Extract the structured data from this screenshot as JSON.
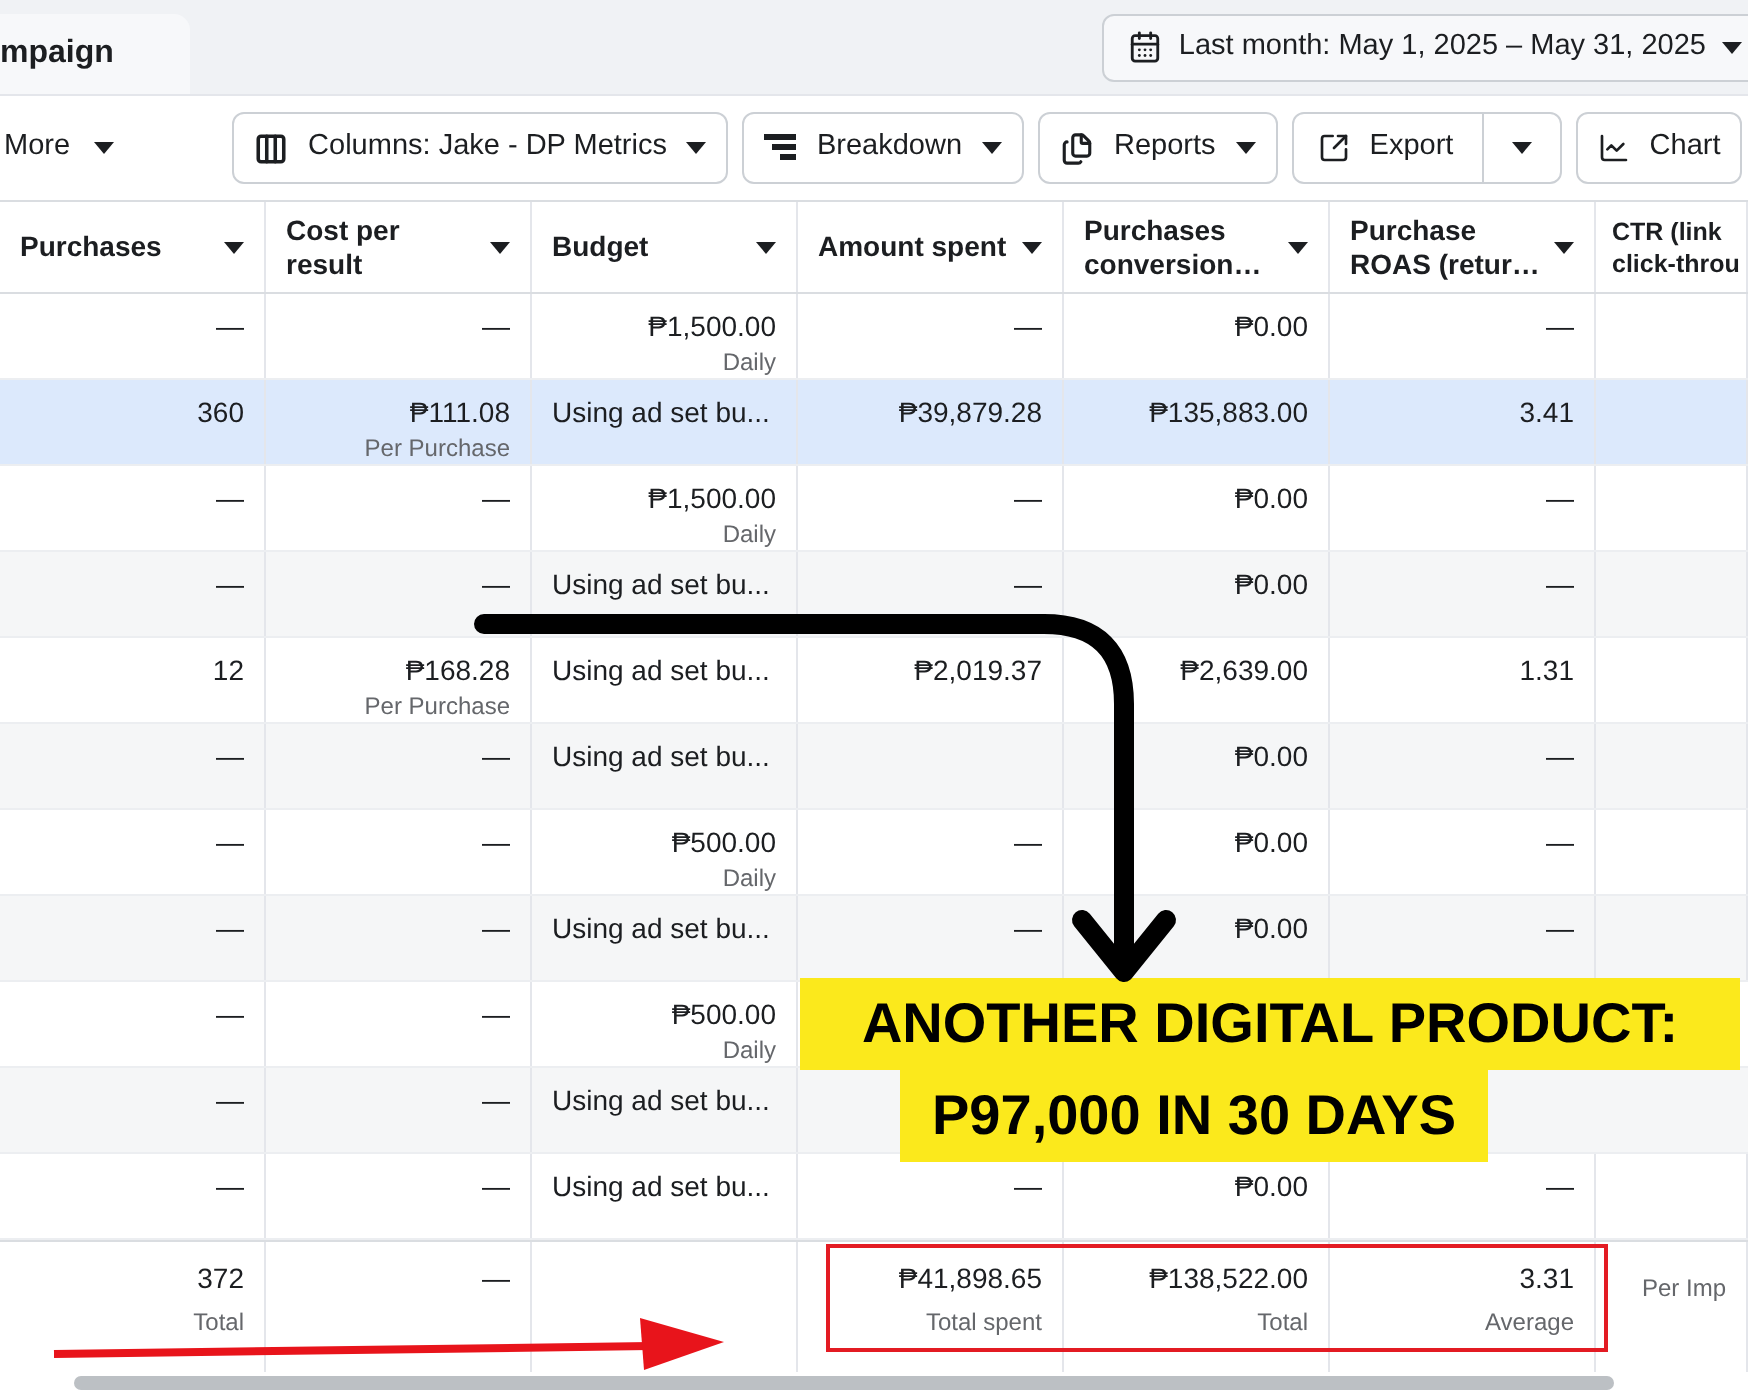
{
  "tab": {
    "label": "mpaign"
  },
  "date_range": {
    "label": "Last month: May 1, 2025 – May 31, 2025"
  },
  "toolbar": [
    {
      "label": "More",
      "kind": "plain"
    },
    {
      "label": "Columns: Jake - DP Metrics",
      "kind": "button"
    },
    {
      "label": "Breakdown",
      "kind": "button"
    },
    {
      "label": "Reports",
      "kind": "button"
    },
    {
      "label": "Export",
      "kind": "split"
    },
    {
      "label": "Chart",
      "kind": "button"
    }
  ],
  "table": {
    "columns": [
      "Purchases",
      "Cost per result",
      "Budget",
      "Amount spent",
      "Purchases conversion…",
      "Purchase ROAS (retur…",
      "CTR (link click-throu"
    ],
    "rows": [
      {
        "selected": false,
        "purchases": {
          "value": "—"
        },
        "cost": {
          "value": "—"
        },
        "budget": {
          "value": "₱1,500.00",
          "sub": "Daily"
        },
        "amount": {
          "value": "—"
        },
        "conversion": {
          "value": "₱0.00"
        },
        "roas": {
          "value": "—"
        }
      },
      {
        "selected": true,
        "purchases": {
          "value": "360"
        },
        "cost": {
          "value": "₱111.08",
          "sub": "Per Purchase"
        },
        "budget": {
          "value": "Using ad set bu...",
          "kind": "text"
        },
        "amount": {
          "value": "₱39,879.28"
        },
        "conversion": {
          "value": "₱135,883.00"
        },
        "roas": {
          "value": "3.41"
        }
      },
      {
        "selected": false,
        "purchases": {
          "value": "—"
        },
        "cost": {
          "value": "—"
        },
        "budget": {
          "value": "₱1,500.00",
          "sub": "Daily"
        },
        "amount": {
          "value": "—"
        },
        "conversion": {
          "value": "₱0.00"
        },
        "roas": {
          "value": "—"
        }
      },
      {
        "selected": false,
        "purchases": {
          "value": "—"
        },
        "cost": {
          "value": "—"
        },
        "budget": {
          "value": "Using ad set bu...",
          "kind": "text"
        },
        "amount": {
          "value": "—"
        },
        "conversion": {
          "value": "₱0.00"
        },
        "roas": {
          "value": "—"
        }
      },
      {
        "selected": false,
        "purchases": {
          "value": "12"
        },
        "cost": {
          "value": "₱168.28",
          "sub": "Per Purchase"
        },
        "budget": {
          "value": "Using ad set bu...",
          "kind": "text"
        },
        "amount": {
          "value": "₱2,019.37"
        },
        "conversion": {
          "value": "₱2,639.00"
        },
        "roas": {
          "value": "1.31"
        }
      },
      {
        "selected": false,
        "purchases": {
          "value": "—"
        },
        "cost": {
          "value": "—"
        },
        "budget": {
          "value": "Using ad set bu...",
          "kind": "text"
        },
        "conversion": {
          "value": "₱0.00"
        },
        "roas": {
          "value": "—"
        }
      },
      {
        "selected": false,
        "purchases": {
          "value": "—"
        },
        "cost": {
          "value": "—"
        },
        "budget": {
          "value": "₱500.00",
          "sub": "Daily"
        },
        "amount": {
          "value": "—"
        },
        "conversion": {
          "value": "₱0.00"
        },
        "roas": {
          "value": "—"
        }
      },
      {
        "selected": false,
        "purchases": {
          "value": "—"
        },
        "cost": {
          "value": "—"
        },
        "budget": {
          "value": "Using ad set bu...",
          "kind": "text"
        },
        "amount": {
          "value": "—"
        },
        "conversion": {
          "value": "₱0.00"
        },
        "roas": {
          "value": "—"
        }
      },
      {
        "selected": false,
        "purchases": {
          "value": "—"
        },
        "cost": {
          "value": "—"
        },
        "budget": {
          "value": "₱500.00",
          "sub": "Daily"
        }
      },
      {
        "selected": false,
        "purchases": {
          "value": "—"
        },
        "cost": {
          "value": "—"
        },
        "budget": {
          "value": "Using ad set bu...",
          "kind": "text"
        }
      },
      {
        "selected": false,
        "purchases": {
          "value": "—"
        },
        "cost": {
          "value": "—"
        },
        "budget": {
          "value": "Using ad set bu...",
          "kind": "text"
        },
        "amount": {
          "value": "—"
        },
        "conversion": {
          "value": "₱0.00"
        },
        "roas": {
          "value": "—"
        }
      }
    ],
    "totals": {
      "purchases": {
        "value": "372",
        "sub": "Total"
      },
      "cost": {
        "value": "—"
      },
      "amount": {
        "value": "₱41,898.65",
        "sub": "Total spent"
      },
      "conversion": {
        "value": "₱138,522.00",
        "sub": "Total"
      },
      "roas": {
        "value": "3.31",
        "sub": "Average"
      },
      "ctr": {
        "sub": "Per Imp"
      }
    }
  },
  "annotation": {
    "lines": [
      "ANOTHER DIGITAL PRODUCT:",
      "P97,000 IN 30 DAYS"
    ]
  }
}
